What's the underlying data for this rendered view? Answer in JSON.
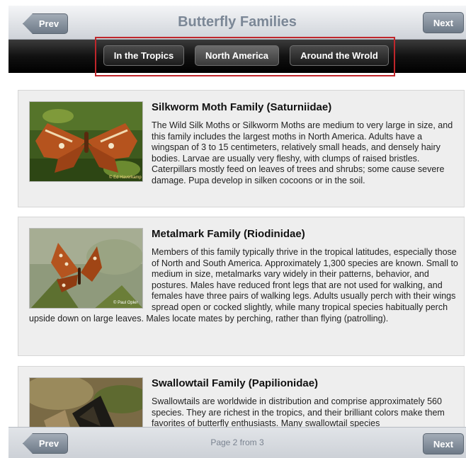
{
  "header": {
    "title": "Butterfly Families",
    "prev_label": "Prev",
    "next_label": "Next"
  },
  "tabs": [
    {
      "label": "In the Tropics",
      "active": false
    },
    {
      "label": "North America",
      "active": true
    },
    {
      "label": "Around the Wrold",
      "active": false
    }
  ],
  "families": [
    {
      "title": "Silkworm Moth Family (Saturniidae)",
      "description": "The Wild Silk Moths or Silkworm Moths are medium to very large in size, and this family includes the largest moths in North America. Adults have a wingspan of 3 to 15 centimeters, relatively small heads, and densely hairy bodies. Larvae are usually very fleshy, with clumps of raised bristles. Caterpillars mostly feed on leaves of trees and shrubs; some cause severe damage. Pupa develop in silken cocoons or in the soil.",
      "photo_credit": "© Ed Haverkamp"
    },
    {
      "title": "Metalmark Family (Riodinidae)",
      "description": "Members of this family typically thrive in the tropical latitudes, especially those of North and South America. Approximately 1,300 species are known. Small to medium in size, metalmarks vary widely in their patterns, behavior, and postures. Males have reduced front legs that are not used for walking, and females have three pairs of walking legs. Adults usually perch with their wings spread open or cocked slightly, while many tropical species habitually perch upside down on large leaves. Males locate mates by perching, rather than flying (patrolling).",
      "photo_credit": "© Paul Opler"
    },
    {
      "title": "Swallowtail Family (Papilionidae)",
      "description": "Swallowtails are worldwide in distribution and comprise approximately 560 species. They are richest in the tropics, and their brilliant colors make them favorites of butterfly enthusiasts. Many swallowtail species"
    }
  ],
  "footer": {
    "prev_label": "Prev",
    "next_label": "Next",
    "page_info": "Page 2 from 3"
  }
}
